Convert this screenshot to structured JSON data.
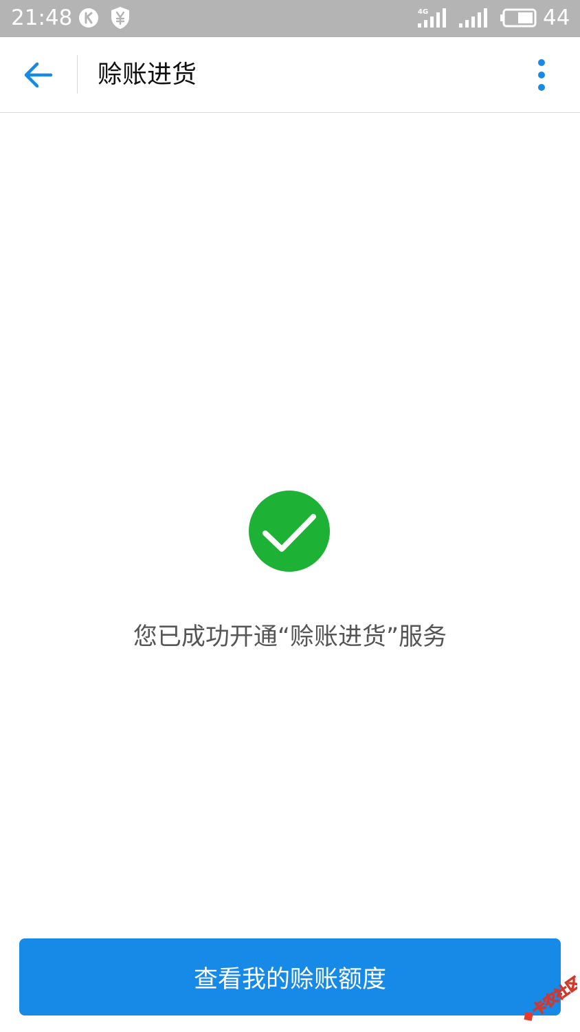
{
  "status_bar": {
    "time": "21:48",
    "network_label": "4G",
    "battery_level": "44",
    "icons": [
      "k-app-icon",
      "shield-yen-icon",
      "signal-4g-icon",
      "signal-icon",
      "battery-icon"
    ]
  },
  "toolbar": {
    "title": "赊账进货",
    "back_icon": "arrow-left-icon",
    "more_icon": "more-vertical-icon"
  },
  "success": {
    "icon": "check-circle-icon",
    "message": "您已成功开通“赊账进货”服务"
  },
  "primary_button": {
    "label": "查看我的赊账额度"
  },
  "watermark": {
    "text": "卡农社区"
  },
  "colors": {
    "status_bar": "#b4b4b4",
    "accent": "#1789e6",
    "success": "#1db135",
    "title_text": "#111111",
    "body_text": "#555555"
  }
}
